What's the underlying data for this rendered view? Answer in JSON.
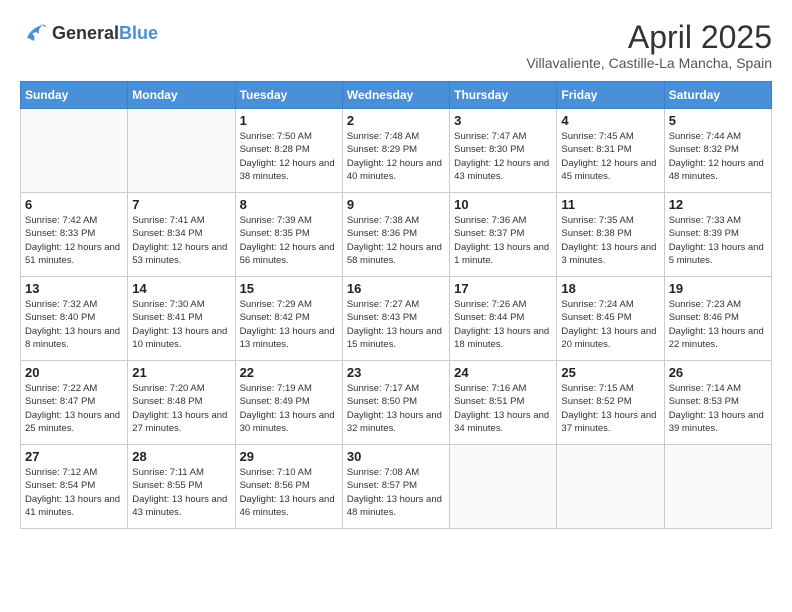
{
  "logo": {
    "general": "General",
    "blue": "Blue"
  },
  "title": "April 2025",
  "subtitle": "Villavaliente, Castille-La Mancha, Spain",
  "days_of_week": [
    "Sunday",
    "Monday",
    "Tuesday",
    "Wednesday",
    "Thursday",
    "Friday",
    "Saturday"
  ],
  "weeks": [
    [
      {
        "day": "",
        "info": ""
      },
      {
        "day": "",
        "info": ""
      },
      {
        "day": "1",
        "info": "Sunrise: 7:50 AM\nSunset: 8:28 PM\nDaylight: 12 hours and 38 minutes."
      },
      {
        "day": "2",
        "info": "Sunrise: 7:48 AM\nSunset: 8:29 PM\nDaylight: 12 hours and 40 minutes."
      },
      {
        "day": "3",
        "info": "Sunrise: 7:47 AM\nSunset: 8:30 PM\nDaylight: 12 hours and 43 minutes."
      },
      {
        "day": "4",
        "info": "Sunrise: 7:45 AM\nSunset: 8:31 PM\nDaylight: 12 hours and 45 minutes."
      },
      {
        "day": "5",
        "info": "Sunrise: 7:44 AM\nSunset: 8:32 PM\nDaylight: 12 hours and 48 minutes."
      }
    ],
    [
      {
        "day": "6",
        "info": "Sunrise: 7:42 AM\nSunset: 8:33 PM\nDaylight: 12 hours and 51 minutes."
      },
      {
        "day": "7",
        "info": "Sunrise: 7:41 AM\nSunset: 8:34 PM\nDaylight: 12 hours and 53 minutes."
      },
      {
        "day": "8",
        "info": "Sunrise: 7:39 AM\nSunset: 8:35 PM\nDaylight: 12 hours and 56 minutes."
      },
      {
        "day": "9",
        "info": "Sunrise: 7:38 AM\nSunset: 8:36 PM\nDaylight: 12 hours and 58 minutes."
      },
      {
        "day": "10",
        "info": "Sunrise: 7:36 AM\nSunset: 8:37 PM\nDaylight: 13 hours and 1 minute."
      },
      {
        "day": "11",
        "info": "Sunrise: 7:35 AM\nSunset: 8:38 PM\nDaylight: 13 hours and 3 minutes."
      },
      {
        "day": "12",
        "info": "Sunrise: 7:33 AM\nSunset: 8:39 PM\nDaylight: 13 hours and 5 minutes."
      }
    ],
    [
      {
        "day": "13",
        "info": "Sunrise: 7:32 AM\nSunset: 8:40 PM\nDaylight: 13 hours and 8 minutes."
      },
      {
        "day": "14",
        "info": "Sunrise: 7:30 AM\nSunset: 8:41 PM\nDaylight: 13 hours and 10 minutes."
      },
      {
        "day": "15",
        "info": "Sunrise: 7:29 AM\nSunset: 8:42 PM\nDaylight: 13 hours and 13 minutes."
      },
      {
        "day": "16",
        "info": "Sunrise: 7:27 AM\nSunset: 8:43 PM\nDaylight: 13 hours and 15 minutes."
      },
      {
        "day": "17",
        "info": "Sunrise: 7:26 AM\nSunset: 8:44 PM\nDaylight: 13 hours and 18 minutes."
      },
      {
        "day": "18",
        "info": "Sunrise: 7:24 AM\nSunset: 8:45 PM\nDaylight: 13 hours and 20 minutes."
      },
      {
        "day": "19",
        "info": "Sunrise: 7:23 AM\nSunset: 8:46 PM\nDaylight: 13 hours and 22 minutes."
      }
    ],
    [
      {
        "day": "20",
        "info": "Sunrise: 7:22 AM\nSunset: 8:47 PM\nDaylight: 13 hours and 25 minutes."
      },
      {
        "day": "21",
        "info": "Sunrise: 7:20 AM\nSunset: 8:48 PM\nDaylight: 13 hours and 27 minutes."
      },
      {
        "day": "22",
        "info": "Sunrise: 7:19 AM\nSunset: 8:49 PM\nDaylight: 13 hours and 30 minutes."
      },
      {
        "day": "23",
        "info": "Sunrise: 7:17 AM\nSunset: 8:50 PM\nDaylight: 13 hours and 32 minutes."
      },
      {
        "day": "24",
        "info": "Sunrise: 7:16 AM\nSunset: 8:51 PM\nDaylight: 13 hours and 34 minutes."
      },
      {
        "day": "25",
        "info": "Sunrise: 7:15 AM\nSunset: 8:52 PM\nDaylight: 13 hours and 37 minutes."
      },
      {
        "day": "26",
        "info": "Sunrise: 7:14 AM\nSunset: 8:53 PM\nDaylight: 13 hours and 39 minutes."
      }
    ],
    [
      {
        "day": "27",
        "info": "Sunrise: 7:12 AM\nSunset: 8:54 PM\nDaylight: 13 hours and 41 minutes."
      },
      {
        "day": "28",
        "info": "Sunrise: 7:11 AM\nSunset: 8:55 PM\nDaylight: 13 hours and 43 minutes."
      },
      {
        "day": "29",
        "info": "Sunrise: 7:10 AM\nSunset: 8:56 PM\nDaylight: 13 hours and 46 minutes."
      },
      {
        "day": "30",
        "info": "Sunrise: 7:08 AM\nSunset: 8:57 PM\nDaylight: 13 hours and 48 minutes."
      },
      {
        "day": "",
        "info": ""
      },
      {
        "day": "",
        "info": ""
      },
      {
        "day": "",
        "info": ""
      }
    ]
  ]
}
